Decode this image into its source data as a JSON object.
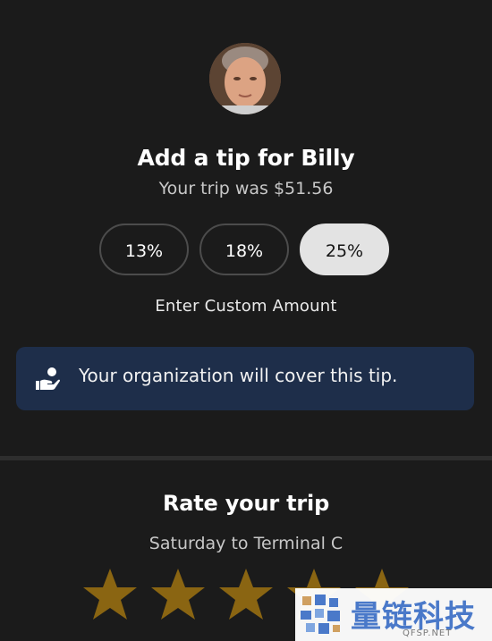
{
  "tip": {
    "title": "Add a tip for Billy",
    "subtitle": "Your trip was $51.56",
    "options": [
      {
        "label": "13%",
        "selected": false
      },
      {
        "label": "18%",
        "selected": false
      },
      {
        "label": "25%",
        "selected": true
      }
    ],
    "custom_amount_label": "Enter Custom Amount",
    "avatar_icon": "driver-photo"
  },
  "org_notice": {
    "icon": "hand-with-person-icon",
    "text": "Your organization will cover this tip.",
    "bg_color": "#1e2e4a"
  },
  "rating": {
    "title": "Rate your trip",
    "subtitle": "Saturday to Terminal C",
    "stars": 5,
    "star_color": "#8a6512"
  },
  "watermark": {
    "text_cn": "量链科技",
    "text_en": "QFSP.NET"
  },
  "colors": {
    "background": "#1b1b1b",
    "selected_option": "#e3e3e3",
    "divider": "#2e2e2e"
  }
}
